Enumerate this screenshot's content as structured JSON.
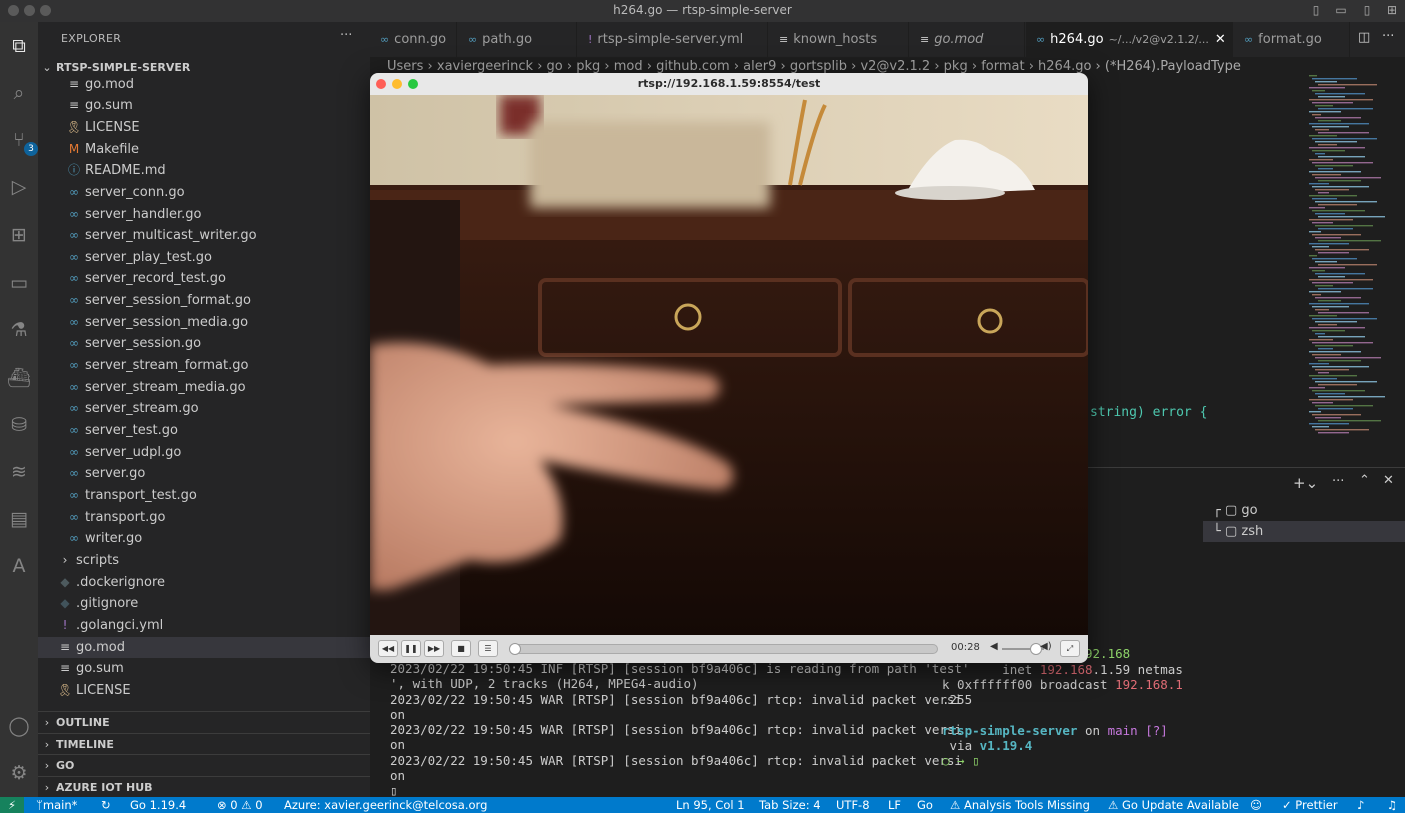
{
  "window": {
    "title": "h264.go — rtsp-simple-server"
  },
  "activity_bar": {
    "source_control_badge": "3"
  },
  "explorer": {
    "title": "EXPLORER",
    "more": "···",
    "root": "RTSP-SIMPLE-SERVER",
    "files": [
      {
        "name": "go.mod",
        "icon": "≡",
        "color": "#cccccc"
      },
      {
        "name": "go.sum",
        "icon": "≡",
        "color": "#cccccc"
      },
      {
        "name": "LICENSE",
        "icon": "🎗",
        "color": "#e2c08d"
      },
      {
        "name": "Makefile",
        "icon": "M",
        "color": "#e37933"
      },
      {
        "name": "README.md",
        "icon": "ⓘ",
        "color": "#519aba"
      },
      {
        "name": "server_conn.go",
        "icon": "∞",
        "color": "#519aba"
      },
      {
        "name": "server_handler.go",
        "icon": "∞",
        "color": "#519aba"
      },
      {
        "name": "server_multicast_writer.go",
        "icon": "∞",
        "color": "#519aba"
      },
      {
        "name": "server_play_test.go",
        "icon": "∞",
        "color": "#519aba"
      },
      {
        "name": "server_record_test.go",
        "icon": "∞",
        "color": "#519aba"
      },
      {
        "name": "server_session_format.go",
        "icon": "∞",
        "color": "#519aba"
      },
      {
        "name": "server_session_media.go",
        "icon": "∞",
        "color": "#519aba"
      },
      {
        "name": "server_session.go",
        "icon": "∞",
        "color": "#519aba"
      },
      {
        "name": "server_stream_format.go",
        "icon": "∞",
        "color": "#519aba"
      },
      {
        "name": "server_stream_media.go",
        "icon": "∞",
        "color": "#519aba"
      },
      {
        "name": "server_stream.go",
        "icon": "∞",
        "color": "#519aba"
      },
      {
        "name": "server_test.go",
        "icon": "∞",
        "color": "#519aba"
      },
      {
        "name": "server_udpl.go",
        "icon": "∞",
        "color": "#519aba"
      },
      {
        "name": "server.go",
        "icon": "∞",
        "color": "#519aba"
      },
      {
        "name": "transport_test.go",
        "icon": "∞",
        "color": "#519aba"
      },
      {
        "name": "transport.go",
        "icon": "∞",
        "color": "#519aba"
      },
      {
        "name": "writer.go",
        "icon": "∞",
        "color": "#519aba"
      }
    ],
    "outer_items": [
      {
        "name": "scripts",
        "icon": "›",
        "color": "#cccccc"
      },
      {
        "name": ".dockerignore",
        "icon": "◆",
        "color": "#4d5a5e"
      },
      {
        "name": ".gitignore",
        "icon": "◆",
        "color": "#41535b"
      },
      {
        "name": ".golangci.yml",
        "icon": "!",
        "color": "#a074c4"
      },
      {
        "name": "go.mod",
        "icon": "≡",
        "color": "#cccccc"
      },
      {
        "name": "go.sum",
        "icon": "≡",
        "color": "#cccccc"
      },
      {
        "name": "LICENSE",
        "icon": "🎗",
        "color": "#e2c08d"
      }
    ],
    "sections": [
      "OUTLINE",
      "TIMELINE",
      "GO",
      "AZURE IOT HUB"
    ]
  },
  "tabs": [
    {
      "label": "conn.go",
      "icon": "∞"
    },
    {
      "label": "path.go",
      "icon": "∞"
    },
    {
      "label": "rtsp-simple-server.yml",
      "icon": "!"
    },
    {
      "label": "known_hosts",
      "icon": "≡"
    },
    {
      "label": "go.mod",
      "icon": "≡"
    },
    {
      "label": "h264.go",
      "icon": "∞",
      "desc": "~/.../v2@v2.1.2/...",
      "active": true
    },
    {
      "label": "format.go",
      "icon": "∞"
    }
  ],
  "breadcrumb": [
    "Users",
    "xaviergeerinck",
    "go",
    "pkg",
    "mod",
    "github.com",
    "aler9",
    "gortsplib",
    "v2@v2.1.2",
    "pkg",
    "format",
    "h264.go",
    "(*H264).PayloadType"
  ],
  "code_fragment": {
    "text": "string) error {"
  },
  "player": {
    "title": "rtsp://192.168.1.59:8554/test",
    "time": "00:28",
    "progress": 0.0,
    "volume": 0.8
  },
  "terminal_left": [
    "2023/02/22 19:50:45 INF [RTSP] [session bf9a406c] is reading from path 'test'",
    "', with UDP, 2 tracks (H264, MPEG4-audio)",
    "2023/02/22 19:50:45 WAR [RTSP] [session bf9a406c] rtcp: invalid packet versi",
    "on",
    "2023/02/22 19:50:45 WAR [RTSP] [session bf9a406c] rtcp: invalid packet versi",
    "on",
    "2023/02/22 19:50:45 WAR [RTSP] [session bf9a406c] rtcp: invalid packet versi",
    "on"
  ],
  "terminal_right": {
    "prompt1_tail": "on ",
    "branch": "main [?]",
    "cmd": "ifconfig | grep 192.168",
    "inet_line_a": "        inet ",
    "inet_ip": "192.168",
    "inet_line_b": ".1.59 netmas",
    "mask_line": "k 0xffffff00 broadcast ",
    "broadcast": "192.168.1",
    "bc_tail": ".255",
    "project": "rtsp-simple-server",
    "on_word": " on ",
    "via": " via ",
    "go_version": "v1.19.4"
  },
  "terminal_list": [
    "go",
    "zsh"
  ],
  "statusbar": {
    "branch": "main*",
    "go_version": "Go 1.19.4",
    "problems": "⊗ 0 ⚠ 0",
    "azure": "Azure: xavier.geerinck@telcosa.org",
    "cursor": "Ln 95, Col 1",
    "tab_size": "Tab Size: 4",
    "encoding": "UTF-8",
    "eol": "LF",
    "language": "Go",
    "analysis": "⚠ Analysis Tools Missing",
    "update": "⚠ Go Update Available",
    "prettier": "✓ Prettier"
  }
}
